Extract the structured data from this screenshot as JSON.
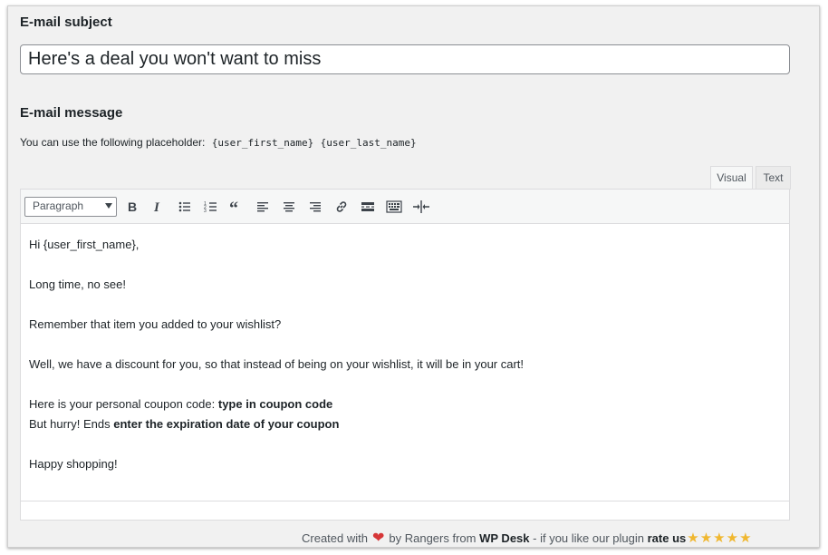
{
  "subject": {
    "label": "E-mail subject",
    "value": "Here's a deal you won't want to miss"
  },
  "message": {
    "label": "E-mail message",
    "hint": "You can use the following placeholder:",
    "placeholders": [
      "{user_first_name}",
      "{user_last_name}"
    ]
  },
  "editor": {
    "tabs": {
      "visual": "Visual",
      "text": "Text"
    },
    "format_select": "Paragraph",
    "toolbar_icons": [
      "bold-icon",
      "italic-icon",
      "bullet-list-icon",
      "numbered-list-icon",
      "blockquote-icon",
      "align-left-icon",
      "align-center-icon",
      "align-right-icon",
      "link-icon",
      "read-more-icon",
      "toolbar-toggle-icon",
      "fullscreen-icon"
    ],
    "content": {
      "greeting": "Hi {user_first_name},",
      "line2": "Long time, no see!",
      "line3": "Remember that item you added to your wishlist?",
      "line4": "Well, we have a discount for you, so that instead of being on your wishlist, it will be in your cart!",
      "coupon_prefix": "Here is your personal coupon code: ",
      "coupon_code": "type in coupon code",
      "expiry_prefix": "But hurry! Ends ",
      "expiry_date": "enter the expiration date of your coupon",
      "closing": "Happy shopping!"
    }
  },
  "footer": {
    "created_with": "Created with",
    "by": "by Rangers from",
    "brand": "WP Desk",
    "middle": "- if you like our plugin",
    "rate": "rate us",
    "heart_color": "#d63638",
    "star_color": "#f0b72f",
    "stars": 5
  }
}
